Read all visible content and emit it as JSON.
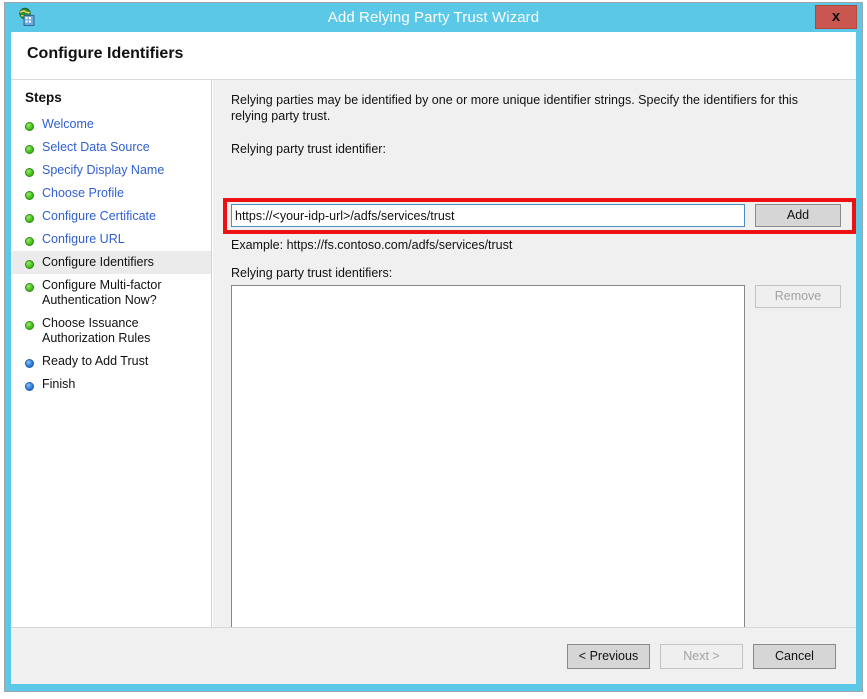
{
  "window": {
    "title": "Add Relying Party Trust Wizard",
    "icon": "adfs-globe-icon",
    "close_label": "x",
    "frame_color": "#5bc8e8",
    "close_color": "#c9574f"
  },
  "header": {
    "title": "Configure Identifiers"
  },
  "sidebar": {
    "heading": "Steps",
    "items": [
      {
        "label": "Welcome",
        "state": "done"
      },
      {
        "label": "Select Data Source",
        "state": "done"
      },
      {
        "label": "Specify Display Name",
        "state": "done"
      },
      {
        "label": "Choose Profile",
        "state": "done"
      },
      {
        "label": "Configure Certificate",
        "state": "done"
      },
      {
        "label": "Configure URL",
        "state": "done"
      },
      {
        "label": "Configure Identifiers",
        "state": "current"
      },
      {
        "label": "Configure Multi-factor Authentication Now?",
        "state": "done"
      },
      {
        "label": "Choose Issuance Authorization Rules",
        "state": "done"
      },
      {
        "label": "Ready to Add Trust",
        "state": "pending"
      },
      {
        "label": "Finish",
        "state": "pending"
      }
    ]
  },
  "content": {
    "intro": "Relying parties may be identified by one or more unique identifier strings. Specify the identifiers for this relying party trust.",
    "identifier_label": "Relying party trust identifier:",
    "identifier_value": "https://<your-idp-url>/adfs/services/trust",
    "identifier_placeholder": "",
    "add_label": "Add",
    "example": "Example: https://fs.contoso.com/adfs/services/trust",
    "identifiers_label": "Relying party trust identifiers:",
    "identifiers_list": [],
    "remove_label": "Remove",
    "highlight_color": "#ee1111"
  },
  "footer": {
    "previous_label": "< Previous",
    "next_label": "Next >",
    "cancel_label": "Cancel"
  }
}
